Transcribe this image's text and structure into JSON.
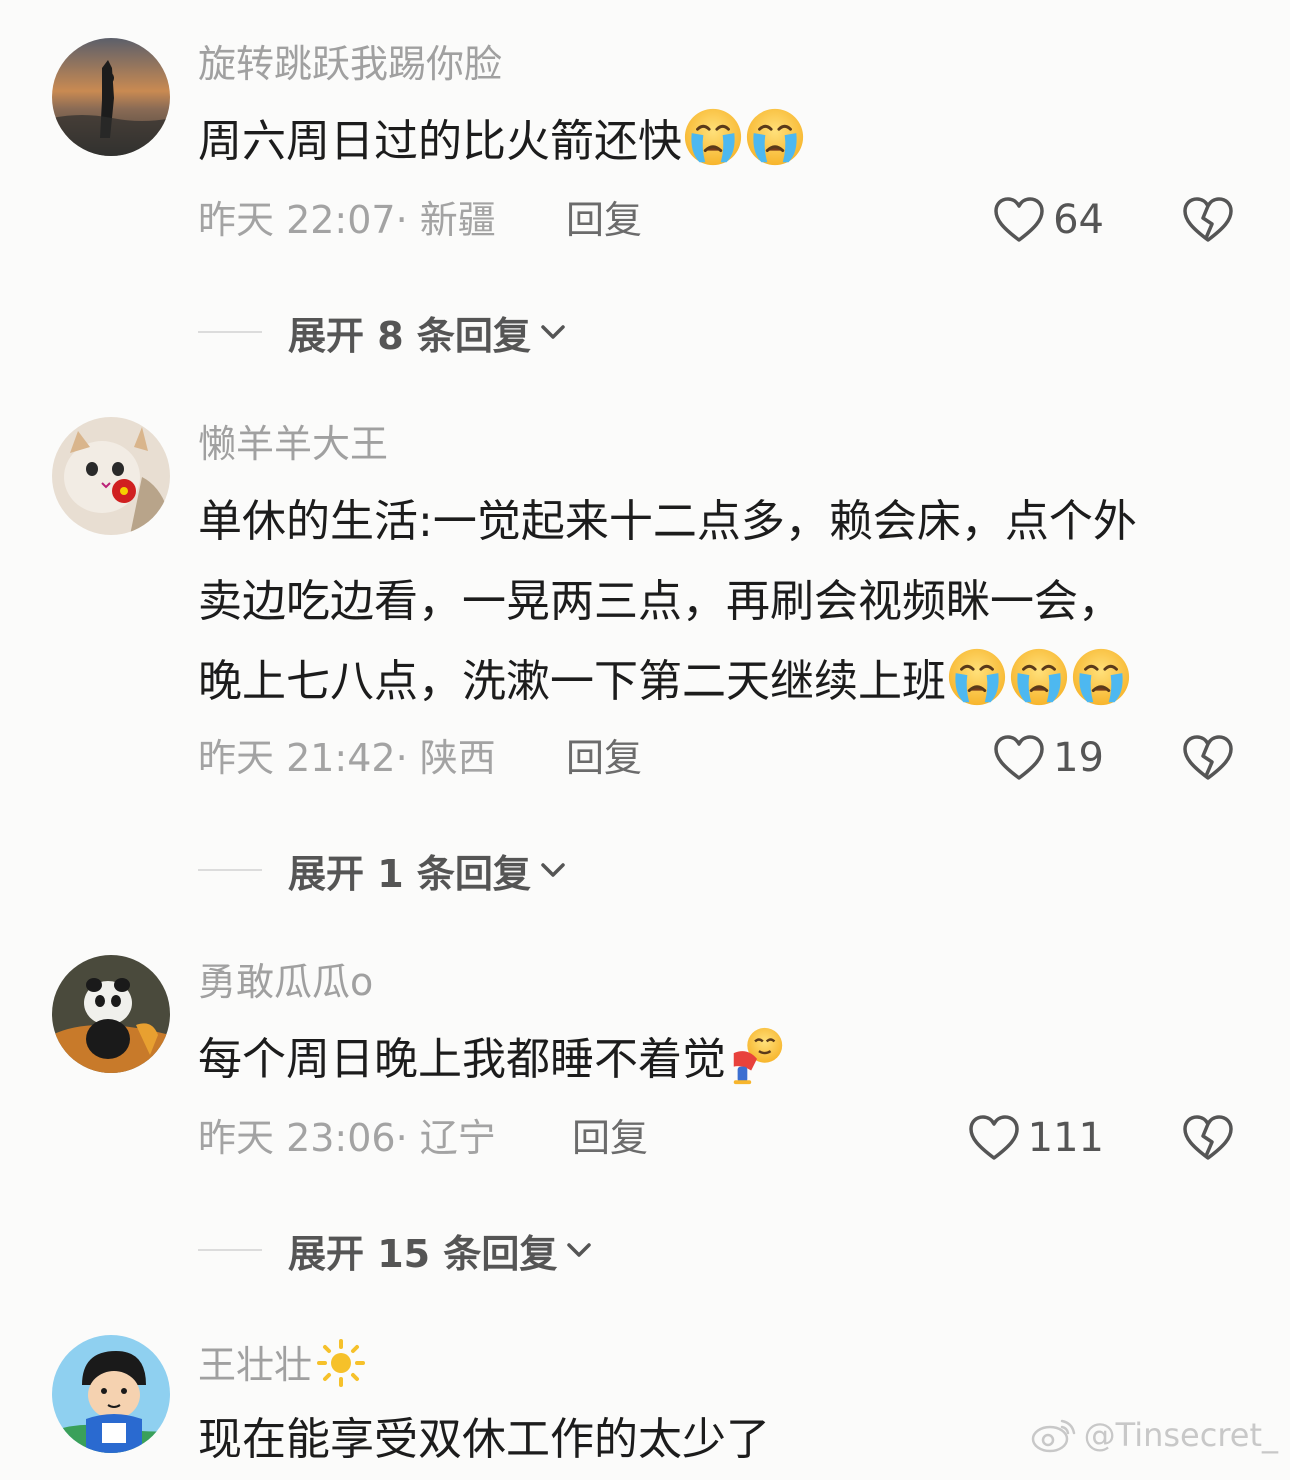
{
  "comments": [
    {
      "username": "旋转跳跃我踢你脸",
      "text": "周六周日过的比火箭还快",
      "time": "昨天 22:07",
      "location": "新疆",
      "reply_label": "回复",
      "likes": "64",
      "expand_label": "展开 8 条回复",
      "avatar_icon": "sunset-silhouette-avatar",
      "emojis": [
        "crying-emoji",
        "crying-emoji"
      ]
    },
    {
      "username": "懒羊羊大王",
      "text_lines": [
        "单休的生活:一觉起来十二点多，赖会床，点个外",
        "卖边吃边看，一晃两三点，再刷会视频眯一会，",
        "晚上七八点，洗漱一下第二天继续上班"
      ],
      "time": "昨天 21:42",
      "location": "陕西",
      "reply_label": "回复",
      "likes": "19",
      "expand_label": "展开 1 条回复",
      "avatar_icon": "cat-with-flower-avatar",
      "emojis": [
        "crying-emoji",
        "crying-emoji",
        "crying-emoji"
      ]
    },
    {
      "username": "勇敢瓜瓜o",
      "text": "每个周日晚上我都睡不着觉",
      "time": "昨天 23:06",
      "location": "辽宁",
      "reply_label": "回复",
      "likes": "111",
      "expand_label": "展开 15 条回复",
      "avatar_icon": "panda-avatar",
      "emojis": [
        "bowing-crying-emoji"
      ]
    },
    {
      "username": "王壮壮",
      "text": "现在能享受双休工作的太少了",
      "avatar_icon": "cartoon-boy-avatar",
      "badge_icon": "sun-icon"
    }
  ],
  "watermark": "@Tinsecret_",
  "colors": {
    "background": "#fbfbfa",
    "username": "#a0a0a0",
    "text": "#1c1c1c",
    "meta": "#a3a3a3"
  }
}
